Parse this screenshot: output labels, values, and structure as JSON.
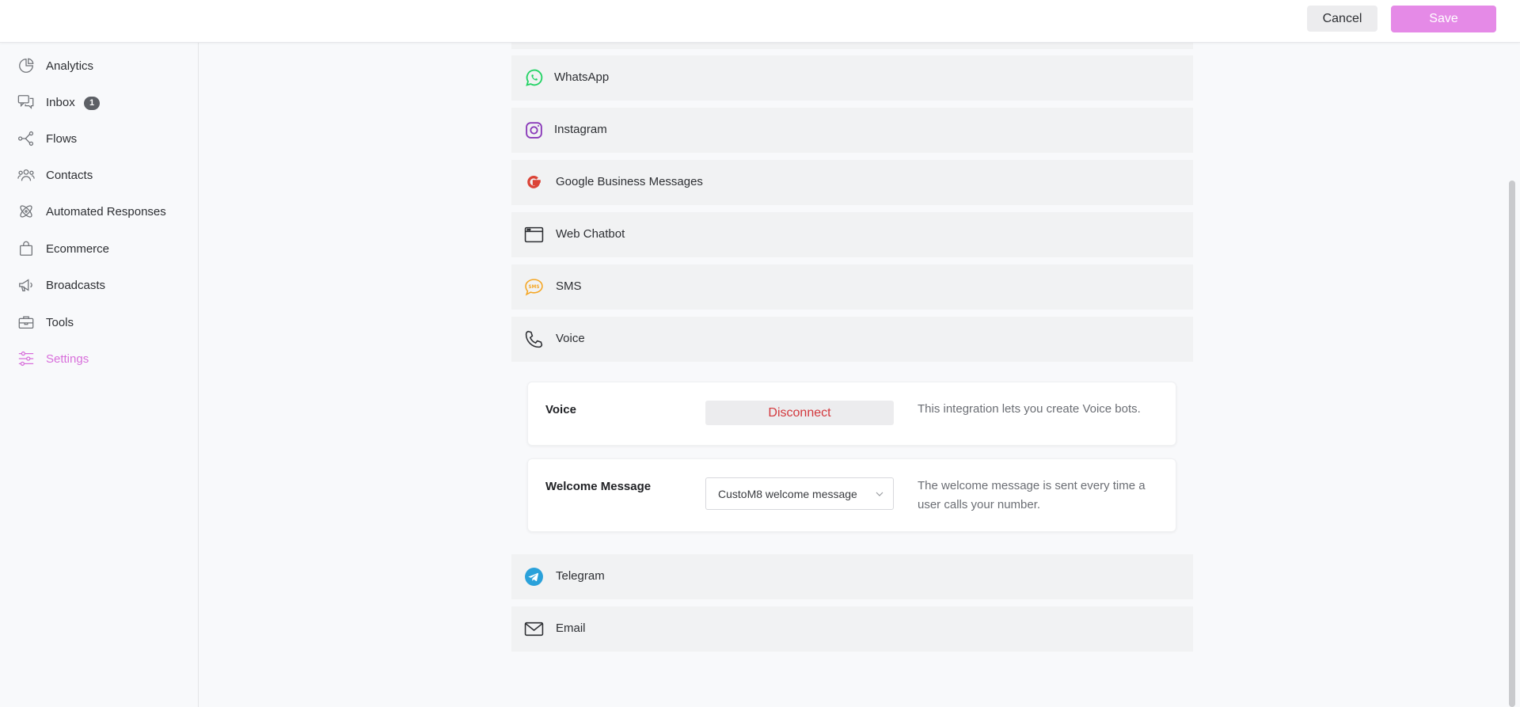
{
  "header": {
    "cancel_label": "Cancel",
    "save_label": "Save"
  },
  "sidebar": {
    "items": [
      {
        "label": "Analytics",
        "icon": "pie-chart-icon"
      },
      {
        "label": "Inbox",
        "icon": "chat-bubbles-icon",
        "badge": "1"
      },
      {
        "label": "Flows",
        "icon": "flow-nodes-icon"
      },
      {
        "label": "Contacts",
        "icon": "people-icon"
      },
      {
        "label": "Automated Responses",
        "icon": "atom-icon"
      },
      {
        "label": "Ecommerce",
        "icon": "shopping-bag-icon"
      },
      {
        "label": "Broadcasts",
        "icon": "megaphone-icon"
      },
      {
        "label": "Tools",
        "icon": "toolbox-icon"
      },
      {
        "label": "Settings",
        "icon": "sliders-icon",
        "active": true
      }
    ]
  },
  "channels": {
    "whatsapp": "WhatsApp",
    "instagram": "Instagram",
    "google": "Google Business Messages",
    "webchat": "Web Chatbot",
    "sms": "SMS",
    "voice": "Voice",
    "telegram": "Telegram",
    "email": "Email"
  },
  "voice_panel": {
    "voice_title": "Voice",
    "disconnect_label": "Disconnect",
    "voice_desc": "This integration lets you create Voice bots.",
    "welcome_title": "Welcome Message",
    "welcome_value": "CustoM8 welcome message",
    "welcome_desc": "The welcome message is sent every time a user calls your number."
  },
  "colors": {
    "accent": "#e58ae7",
    "active_nav": "#d86fdb",
    "danger": "#d3383d",
    "whatsapp": "#25d366",
    "instagram": "#8a3ab9",
    "google": "#db4437",
    "sms": "#f5a623",
    "telegram": "#2aa1da"
  }
}
